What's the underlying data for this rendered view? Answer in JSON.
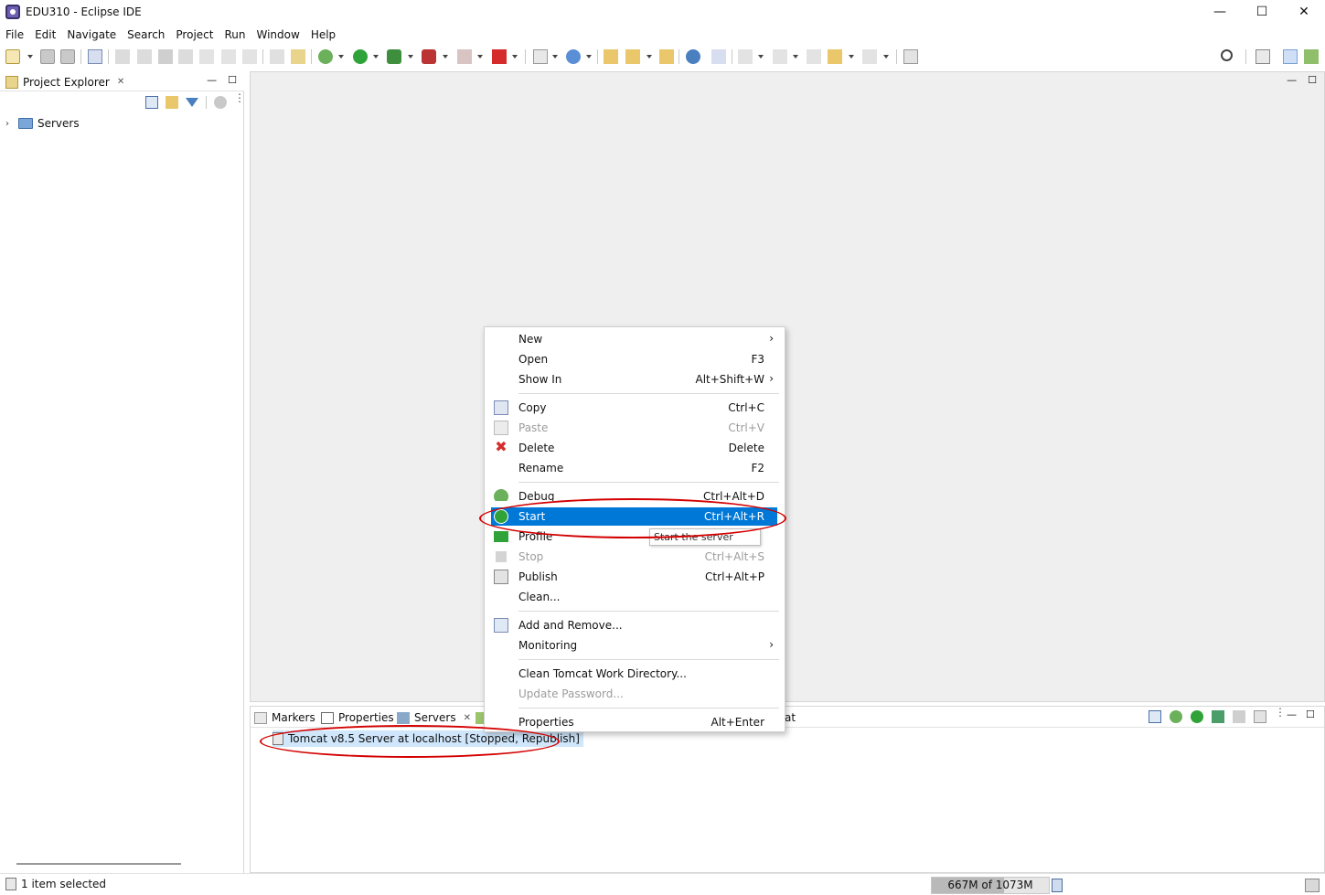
{
  "window": {
    "title": "EDU310 - Eclipse IDE",
    "controls": {
      "minimize": "—",
      "maximize": "☐",
      "close": "✕"
    }
  },
  "menubar": [
    "File",
    "Edit",
    "Navigate",
    "Search",
    "Project",
    "Run",
    "Window",
    "Help"
  ],
  "project_explorer": {
    "tab_label": "Project Explorer",
    "tree": [
      {
        "label": "Servers",
        "expanded": false
      }
    ]
  },
  "bottom_panel": {
    "tabs": [
      {
        "label": "Markers"
      },
      {
        "label": "Properties"
      },
      {
        "label": "Servers"
      }
    ],
    "partial_tab_text": "at",
    "server_row": "Tomcat v8.5 Server at localhost  [Stopped, Republish]"
  },
  "context_menu": {
    "groups": [
      [
        {
          "label": "New",
          "shortcut": "",
          "submenu": true
        },
        {
          "label": "Open",
          "shortcut": "F3"
        },
        {
          "label": "Show In",
          "shortcut": "Alt+Shift+W",
          "submenu": true
        }
      ],
      [
        {
          "label": "Copy",
          "shortcut": "Ctrl+C",
          "icon": "copy-icon"
        },
        {
          "label": "Paste",
          "shortcut": "Ctrl+V",
          "icon": "paste-icon",
          "disabled": true
        },
        {
          "label": "Delete",
          "shortcut": "Delete",
          "icon": "delete-icon"
        },
        {
          "label": "Rename",
          "shortcut": "F2"
        }
      ],
      [
        {
          "label": "Debug",
          "shortcut": "Ctrl+Alt+D",
          "icon": "debug-icon"
        },
        {
          "label": "Start",
          "shortcut": "Ctrl+Alt+R",
          "icon": "start-icon",
          "highlighted": true
        },
        {
          "label": "Profile",
          "shortcut": "",
          "icon": "profile-icon"
        },
        {
          "label": "Stop",
          "shortcut": "Ctrl+Alt+S",
          "icon": "stop-icon",
          "disabled": true
        },
        {
          "label": "Publish",
          "shortcut": "Ctrl+Alt+P",
          "icon": "publish-icon"
        },
        {
          "label": "Clean...",
          "shortcut": ""
        }
      ],
      [
        {
          "label": "Add and Remove...",
          "shortcut": "",
          "icon": "add-remove-icon"
        },
        {
          "label": "Monitoring",
          "shortcut": "",
          "submenu": true
        }
      ],
      [
        {
          "label": "Clean Tomcat Work Directory...",
          "shortcut": ""
        },
        {
          "label": "Update Password...",
          "shortcut": "",
          "disabled": true
        }
      ],
      [
        {
          "label": "Properties",
          "shortcut": "Alt+Enter"
        }
      ]
    ],
    "tooltip": "Start the server"
  },
  "statusbar": {
    "text": "1 item selected",
    "heap": {
      "label": "667M of 1073M",
      "used_fraction": 0.62
    }
  },
  "colors": {
    "highlight": "#0078d7",
    "annotation": "#d40000",
    "editor_bg": "#efefef"
  }
}
